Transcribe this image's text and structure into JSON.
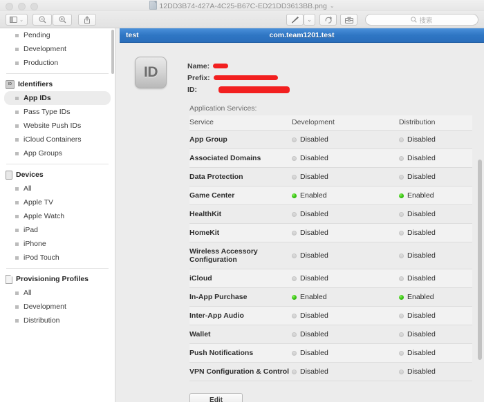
{
  "window": {
    "title": "12DD3B74-427A-4C25-B67C-ED21DD3613BB.png",
    "title_chevron": "⌄",
    "traffic_lights": [
      "close",
      "minimize",
      "zoom"
    ]
  },
  "toolbar": {
    "sidebar_toggle": "sidebar-icon",
    "zoom_out": "zoom-out-icon",
    "zoom_in": "zoom-in-icon",
    "share": "share-icon",
    "markup": "markup-pen-icon",
    "markup_chevron": "⌄",
    "rotate": "rotate-icon",
    "toolbox": "markup-toolbox-icon",
    "search_placeholder": "搜索"
  },
  "sidebar": {
    "groups": [
      {
        "header": null,
        "icon": null,
        "items": [
          {
            "label": "Pending",
            "selected": false
          },
          {
            "label": "Development",
            "selected": false
          },
          {
            "label": "Production",
            "selected": false
          }
        ]
      },
      {
        "header": "Identifiers",
        "icon": "id-icon",
        "icon_text": "ID",
        "items": [
          {
            "label": "App IDs",
            "selected": true
          },
          {
            "label": "Pass Type IDs",
            "selected": false
          },
          {
            "label": "Website Push IDs",
            "selected": false
          },
          {
            "label": "iCloud Containers",
            "selected": false
          },
          {
            "label": "App Groups",
            "selected": false
          }
        ]
      },
      {
        "header": "Devices",
        "icon": "device-icon",
        "items": [
          {
            "label": "All",
            "selected": false
          },
          {
            "label": "Apple TV",
            "selected": false
          },
          {
            "label": "Apple Watch",
            "selected": false
          },
          {
            "label": "iPad",
            "selected": false
          },
          {
            "label": "iPhone",
            "selected": false
          },
          {
            "label": "iPod Touch",
            "selected": false
          }
        ]
      },
      {
        "header": "Provisioning Profiles",
        "icon": "document-icon",
        "items": [
          {
            "label": "All",
            "selected": false
          },
          {
            "label": "Development",
            "selected": false
          },
          {
            "label": "Distribution",
            "selected": false
          }
        ]
      }
    ]
  },
  "content": {
    "header": {
      "left": "test",
      "center": "com.team1201.test"
    },
    "app_id": {
      "badge_text": "ID",
      "fields": [
        {
          "label": "Name:",
          "value_redacted": true,
          "redact_width": 22
        },
        {
          "label": "Prefix:",
          "value_redacted": true,
          "redact_width": 93
        },
        {
          "label": "ID:",
          "value_redacted": true,
          "redact_width": 103
        }
      ]
    },
    "services_title": "Application Services:",
    "table": {
      "columns": [
        "Service",
        "Development",
        "Distribution"
      ],
      "rows": [
        {
          "service": "App Group",
          "development": "Disabled",
          "distribution": "Disabled"
        },
        {
          "service": "Associated Domains",
          "development": "Disabled",
          "distribution": "Disabled"
        },
        {
          "service": "Data Protection",
          "development": "Disabled",
          "distribution": "Disabled"
        },
        {
          "service": "Game Center",
          "development": "Enabled",
          "distribution": "Enabled"
        },
        {
          "service": "HealthKit",
          "development": "Disabled",
          "distribution": "Disabled"
        },
        {
          "service": "HomeKit",
          "development": "Disabled",
          "distribution": "Disabled"
        },
        {
          "service": "Wireless Accessory Configuration",
          "development": "Disabled",
          "distribution": "Disabled"
        },
        {
          "service": "iCloud",
          "development": "Disabled",
          "distribution": "Disabled"
        },
        {
          "service": "In-App Purchase",
          "development": "Enabled",
          "distribution": "Enabled"
        },
        {
          "service": "Inter-App Audio",
          "development": "Disabled",
          "distribution": "Disabled"
        },
        {
          "service": "Wallet",
          "development": "Disabled",
          "distribution": "Disabled"
        },
        {
          "service": "Push Notifications",
          "development": "Disabled",
          "distribution": "Disabled"
        },
        {
          "service": "VPN Configuration & Control",
          "development": "Disabled",
          "distribution": "Disabled"
        }
      ]
    },
    "edit_button": "Edit"
  },
  "colors": {
    "enabled_green": "#3ec918",
    "disabled_gray": "#cfcfcf",
    "header_blue": "#2f76c4",
    "redaction_red": "#f21f1f",
    "selection_gray": "#ececec"
  }
}
